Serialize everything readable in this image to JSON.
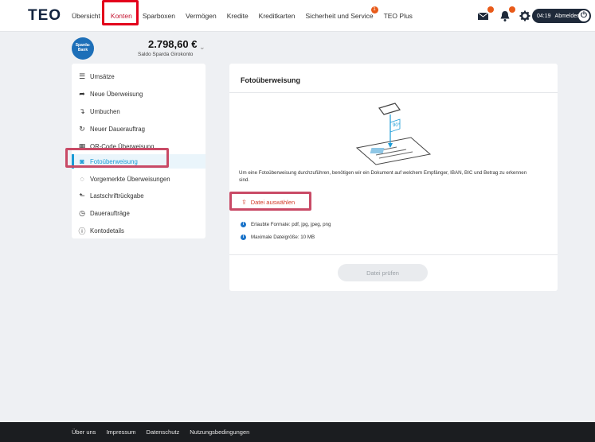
{
  "header": {
    "logo": "TEO",
    "nav": [
      {
        "label": "Übersicht"
      },
      {
        "label": "Konten"
      },
      {
        "label": "Sparboxen"
      },
      {
        "label": "Vermögen"
      },
      {
        "label": "Kredite"
      },
      {
        "label": "Kreditkarten"
      },
      {
        "label": "Sicherheit und Service",
        "badge": "1"
      },
      {
        "label": "TEO Plus"
      }
    ],
    "session_time": "04:19",
    "logout_label": "Abmelden"
  },
  "account": {
    "bank_logo": "Sparda-Bank",
    "balance": "2.798,60 €",
    "balance_label": "Saldo Sparda Girokonto"
  },
  "sidebar": {
    "items": [
      {
        "label": "Umsätze",
        "icon": "list-icon"
      },
      {
        "label": "Neue Überweisung",
        "icon": "arrow-right-icon"
      },
      {
        "label": "Umbuchen",
        "icon": "turn-arrow-icon"
      },
      {
        "label": "Neuer Dauerauftrag",
        "icon": "repeat-icon"
      },
      {
        "label": "QR-Code Überweisung",
        "icon": "qr-code-icon"
      },
      {
        "label": "Fotoüberweisung",
        "icon": "camera-icon",
        "active": true
      },
      {
        "label": "Vorgemerkte Überweisungen",
        "icon": "clock-circle-icon"
      },
      {
        "label": "Lastschriftrückgabe",
        "icon": "return-arrow-icon"
      },
      {
        "label": "Daueraufträge",
        "icon": "timer-icon"
      },
      {
        "label": "Kontodetails",
        "icon": "info-icon"
      }
    ]
  },
  "main": {
    "title": "Fotoüberweisung",
    "illustration_label": "90°",
    "description": "Um eine Fotoüberweisung durchzuführen, benötigen wir ein Dokument auf welchem Empfänger, IBAN, BIC und Betrag zu erkennen sind.",
    "upload_label": "Datei auswählen",
    "info": [
      "Erlaubte Formate: pdf, jpg, jpeg, png",
      "Maximale Dateigröße: 10 MB"
    ],
    "check_button": "Datei prüfen"
  },
  "footer": {
    "links": [
      "Über uns",
      "Impressum",
      "Datenschutz",
      "Nutzungsbedingungen"
    ]
  },
  "colors": {
    "accent_red": "#c4122f",
    "active_blue": "#1a9bd6",
    "highlight_red": "#e3001b",
    "highlight_rose": "#c94a66"
  }
}
